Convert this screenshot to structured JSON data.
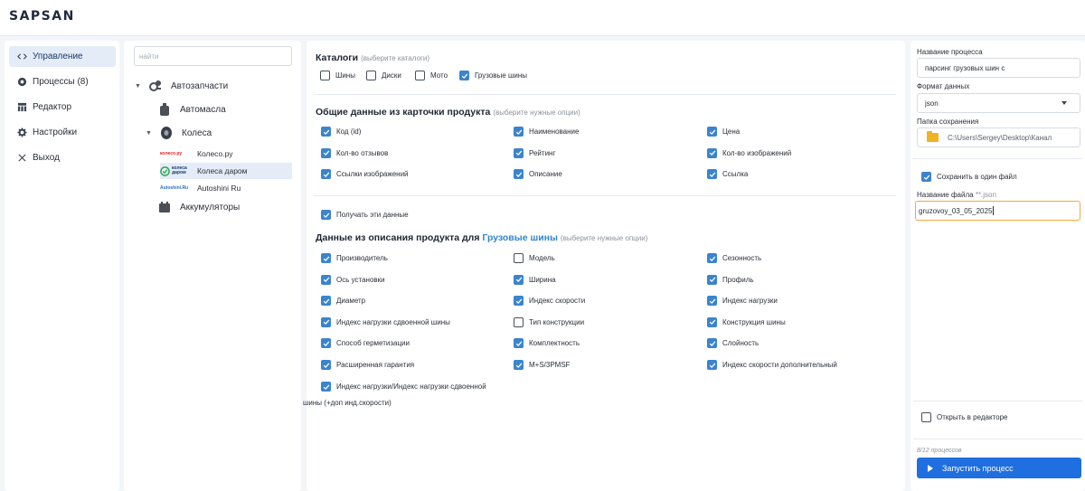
{
  "app": {
    "logo": "SAPSAN"
  },
  "nav": {
    "items": [
      {
        "label": "Управление",
        "icon": "code-arrows-icon",
        "active": true
      },
      {
        "label": "Процессы (8)",
        "icon": "process-icon",
        "active": false
      },
      {
        "label": "Редактор",
        "icon": "table-icon",
        "active": false
      },
      {
        "label": "Настройки",
        "icon": "gear-icon",
        "active": false
      },
      {
        "label": "Выход",
        "icon": "close-icon",
        "active": false
      }
    ]
  },
  "tree": {
    "search_placeholder": "найти",
    "nodes": [
      {
        "label": "Автозапчасти",
        "icon": "autoparts-icon"
      },
      {
        "label": "Автомасла",
        "icon": "oil-can-icon"
      },
      {
        "label": "Колеса",
        "icon": "tire-icon"
      },
      {
        "label": "Аккумуляторы",
        "icon": "battery-icon"
      }
    ],
    "sites": [
      {
        "label": "Колесо.ру",
        "logo_text": "колесо.ру",
        "logo_color": "#d7262b",
        "selected": false
      },
      {
        "label": "Колеса даром",
        "logo_text": "колеса даром",
        "logo_color": "#2aa54a",
        "selected": true
      },
      {
        "label": "Autoshini Ru",
        "logo_text": "Autoshini.Ru",
        "logo_color": "#2f6fbf",
        "selected": false
      }
    ]
  },
  "catalogs": {
    "title": "Каталоги",
    "hint": "(выберите каталоги)",
    "options": [
      {
        "label": "Шины",
        "checked": false
      },
      {
        "label": "Диски",
        "checked": false
      },
      {
        "label": "Мото",
        "checked": false
      },
      {
        "label": "Грузовые шины",
        "checked": true
      }
    ]
  },
  "card_data": {
    "title": "Общие данные из карточки продукта",
    "hint": "(выберите нужные опции)",
    "options": [
      {
        "label": "Код (id)",
        "checked": true
      },
      {
        "label": "Наименование",
        "checked": true
      },
      {
        "label": "Цена",
        "checked": true
      },
      {
        "label": "Кол-во отзывов",
        "checked": true
      },
      {
        "label": "Рейтинг",
        "checked": true
      },
      {
        "label": "Кол-во изображений",
        "checked": true
      },
      {
        "label": "Ссылки изображений",
        "checked": true
      },
      {
        "label": "Описание",
        "checked": true
      },
      {
        "label": "Ссылка",
        "checked": true
      }
    ]
  },
  "get_data": {
    "label": "Получать эти данные",
    "checked": true
  },
  "description": {
    "title_prefix": "Данные из описания продукта для",
    "title_accent": "Грузовые шины",
    "hint": "(выберите нужные опции)",
    "options": [
      {
        "label": "Производитель",
        "checked": true
      },
      {
        "label": "Модель",
        "checked": false
      },
      {
        "label": "Сезонность",
        "checked": true
      },
      {
        "label": "Ось установки",
        "checked": true
      },
      {
        "label": "Ширина",
        "checked": true
      },
      {
        "label": "Профиль",
        "checked": true
      },
      {
        "label": "Диаметр",
        "checked": true
      },
      {
        "label": "Индекс скорости",
        "checked": true
      },
      {
        "label": "Индекс нагрузки",
        "checked": true
      },
      {
        "label": "Индекс нагрузки сдвоенной шины",
        "checked": true
      },
      {
        "label": "Тип конструкции",
        "checked": false
      },
      {
        "label": "Конструкция шины",
        "checked": true
      },
      {
        "label": "Способ герметизации",
        "checked": true
      },
      {
        "label": "Комплектность",
        "checked": true
      },
      {
        "label": "Слойность",
        "checked": true
      },
      {
        "label": "Расширенная гарантия",
        "checked": true
      },
      {
        "label": "M+S/3PMSF",
        "checked": true
      },
      {
        "label": "Индекс скорости дополнительный",
        "checked": true
      }
    ],
    "last_option": {
      "label_line1": "Индекс нагрузки/Индекс нагрузки сдвоенной",
      "label_line2": "шины (+доп инд.скорости)",
      "checked": true
    }
  },
  "side": {
    "process_name_label": "Название процесса",
    "process_name_value": "парсинг грузовых шин с",
    "format_label": "Формат данных",
    "format_value": "json",
    "folder_label": "Папка сохранения",
    "folder_value": "C:\\Users\\Sergey\\Desktop\\Канал",
    "save_one_file_label": "Сохранить в один файл",
    "save_one_file_checked": true,
    "file_name_label": "Название файла",
    "file_name_hint": "**.json",
    "file_name_value": "gruzovoy_03_05_2025",
    "open_editor_label": "Открыть в редакторе",
    "open_editor_checked": false,
    "process_count": "8/12 процессов",
    "run_label": "Запустить процесс"
  },
  "colors": {
    "accent": "#3a84d0",
    "button": "#1f6fe0",
    "focus": "#f2a93b",
    "title_accent": "#2f86d6"
  }
}
